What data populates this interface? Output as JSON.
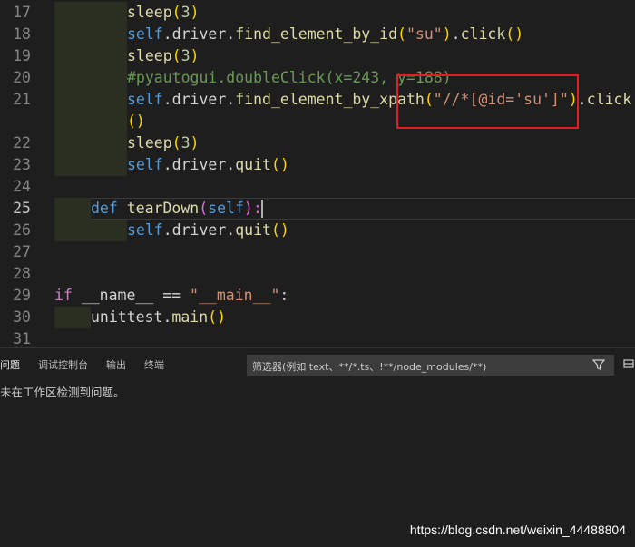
{
  "editor": {
    "lines": [
      {
        "num": "17",
        "indent": 2,
        "segments": [
          {
            "t": "sleep",
            "c": "fn"
          },
          {
            "t": "(",
            "c": "paren"
          },
          {
            "t": "3",
            "c": "num"
          },
          {
            "t": ")",
            "c": "paren"
          }
        ]
      },
      {
        "num": "18",
        "indent": 2,
        "segments": [
          {
            "t": "self",
            "c": "self"
          },
          {
            "t": ".driver.",
            "c": "plain"
          },
          {
            "t": "find_element_by_id",
            "c": "fn"
          },
          {
            "t": "(",
            "c": "paren"
          },
          {
            "t": "\"su\"",
            "c": "str"
          },
          {
            "t": ")",
            "c": "paren"
          },
          {
            "t": ".",
            "c": "plain"
          },
          {
            "t": "click",
            "c": "fn"
          },
          {
            "t": "()",
            "c": "paren"
          }
        ]
      },
      {
        "num": "19",
        "indent": 2,
        "segments": [
          {
            "t": "sleep",
            "c": "fn"
          },
          {
            "t": "(",
            "c": "paren"
          },
          {
            "t": "3",
            "c": "num"
          },
          {
            "t": ")",
            "c": "paren"
          }
        ]
      },
      {
        "num": "20",
        "indent": 2,
        "segments": [
          {
            "t": "#pyautogui.doubleClick(x=243, y=188)",
            "c": "cmt"
          }
        ]
      },
      {
        "num": "21",
        "indent": 2,
        "segments": [
          {
            "t": "self",
            "c": "self"
          },
          {
            "t": ".driver.",
            "c": "plain"
          },
          {
            "t": "find_element_by_xpath",
            "c": "fn"
          },
          {
            "t": "(",
            "c": "paren"
          },
          {
            "t": "\"//*[@id='su']\"",
            "c": "str"
          },
          {
            "t": ")",
            "c": "paren"
          },
          {
            "t": ".",
            "c": "plain"
          },
          {
            "t": "click",
            "c": "fn"
          }
        ]
      },
      {
        "num": "",
        "indent": 2,
        "segments": [
          {
            "t": "()",
            "c": "paren"
          }
        ]
      },
      {
        "num": "22",
        "indent": 2,
        "segments": [
          {
            "t": "sleep",
            "c": "fn"
          },
          {
            "t": "(",
            "c": "paren"
          },
          {
            "t": "3",
            "c": "num"
          },
          {
            "t": ")",
            "c": "paren"
          }
        ]
      },
      {
        "num": "23",
        "indent": 2,
        "segments": [
          {
            "t": "self",
            "c": "self"
          },
          {
            "t": ".driver.",
            "c": "plain"
          },
          {
            "t": "quit",
            "c": "fn"
          },
          {
            "t": "()",
            "c": "paren"
          }
        ]
      },
      {
        "num": "24",
        "indent": 0,
        "segments": []
      },
      {
        "num": "25",
        "indent": 1,
        "segments": [
          {
            "t": "def ",
            "c": "kw"
          },
          {
            "t": "tearDown",
            "c": "fn"
          },
          {
            "t": "(",
            "c": "paren2"
          },
          {
            "t": "self",
            "c": "self"
          },
          {
            "t": "):",
            "c": "paren2"
          }
        ]
      },
      {
        "num": "26",
        "indent": 2,
        "segments": [
          {
            "t": "self",
            "c": "self"
          },
          {
            "t": ".driver.",
            "c": "plain"
          },
          {
            "t": "quit",
            "c": "fn"
          },
          {
            "t": "()",
            "c": "paren"
          }
        ]
      },
      {
        "num": "27",
        "indent": 0,
        "segments": []
      },
      {
        "num": "28",
        "indent": 0,
        "segments": []
      },
      {
        "num": "29",
        "indent": 0,
        "segments": [
          {
            "t": "if ",
            "c": "ctl"
          },
          {
            "t": "__name__",
            "c": "plain"
          },
          {
            "t": " == ",
            "c": "plain"
          },
          {
            "t": "\"__main__\"",
            "c": "str"
          },
          {
            "t": ":",
            "c": "plain"
          }
        ]
      },
      {
        "num": "30",
        "indent": 1,
        "segments": [
          {
            "t": "unittest.",
            "c": "plain"
          },
          {
            "t": "main",
            "c": "fn"
          },
          {
            "t": "()",
            "c": "paren"
          }
        ]
      },
      {
        "num": "31",
        "indent": 0,
        "segments": []
      }
    ]
  },
  "panel": {
    "tabs": [
      {
        "label": "问题",
        "active": true
      },
      {
        "label": "调试控制台",
        "active": false
      },
      {
        "label": "输出",
        "active": false
      },
      {
        "label": "终端",
        "active": false
      }
    ],
    "filter_placeholder": "筛选器(例如 text、**/*.ts、!**/node_modules/**)",
    "message": "未在工作区检测到问题。"
  },
  "watermark": "https://blog.csdn.net/weixin_44488804",
  "icons": {
    "filter": "filter-funnel-icon",
    "collapse": "collapse-panel-icon"
  },
  "colors": {
    "background": "#1e1e1e",
    "highlight": "#e02020",
    "string": "#ce9178",
    "function": "#dcdcaa",
    "keyword": "#569cd6"
  }
}
